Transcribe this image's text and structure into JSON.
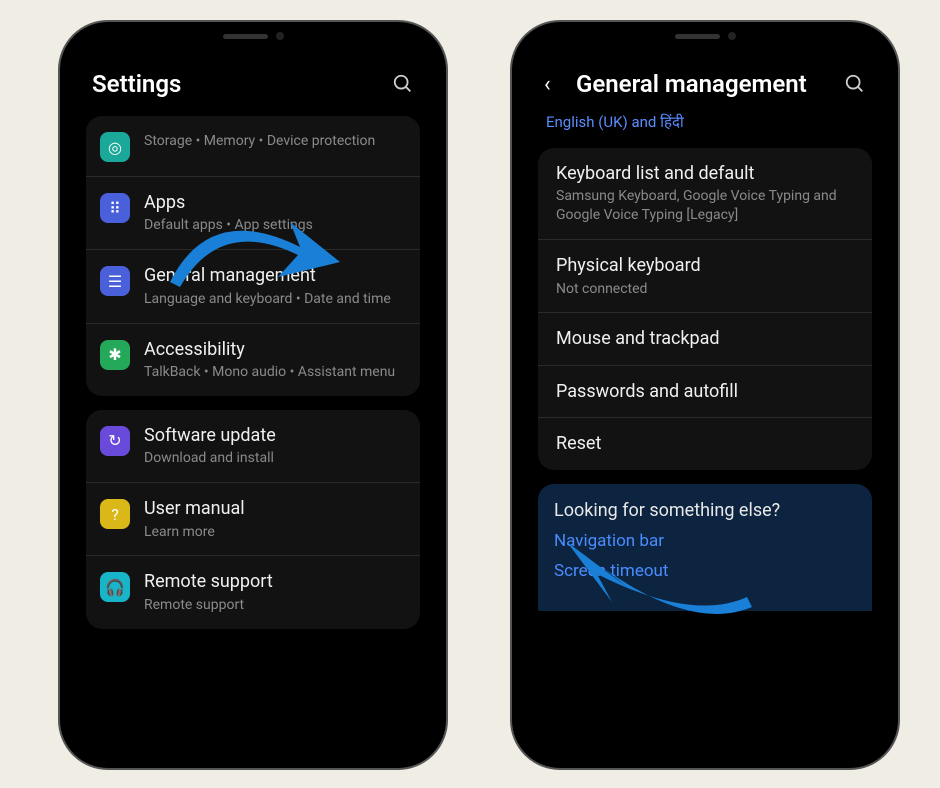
{
  "left": {
    "title": "Settings",
    "items": [
      {
        "icon": "storage",
        "title": "",
        "sub": "Storage  •  Memory  •  Device protection"
      },
      {
        "icon": "apps",
        "title": "Apps",
        "sub": "Default apps  •  App settings"
      },
      {
        "icon": "general",
        "title": "General management",
        "sub": "Language and keyboard  •  Date and time"
      },
      {
        "icon": "access",
        "title": "Accessibility",
        "sub": "TalkBack  •  Mono audio  •  Assistant menu"
      },
      {
        "icon": "update",
        "title": "Software update",
        "sub": "Download and install"
      },
      {
        "icon": "manual",
        "title": "User manual",
        "sub": "Learn more"
      },
      {
        "icon": "remote",
        "title": "Remote support",
        "sub": "Remote support"
      }
    ]
  },
  "right": {
    "title": "General management",
    "top_link": "English (UK) and हिंदी",
    "items": [
      {
        "title": "Keyboard list and default",
        "sub": "Samsung Keyboard, Google Voice Typing and Google Voice Typing [Legacy]"
      },
      {
        "title": "Physical keyboard",
        "sub": "Not connected"
      },
      {
        "title": "Mouse and trackpad",
        "sub": ""
      },
      {
        "title": "Passwords and autofill",
        "sub": ""
      },
      {
        "title": "Reset",
        "sub": ""
      }
    ],
    "looking": {
      "title": "Looking for something else?",
      "links": [
        "Navigation bar",
        "Screen timeout"
      ]
    }
  }
}
